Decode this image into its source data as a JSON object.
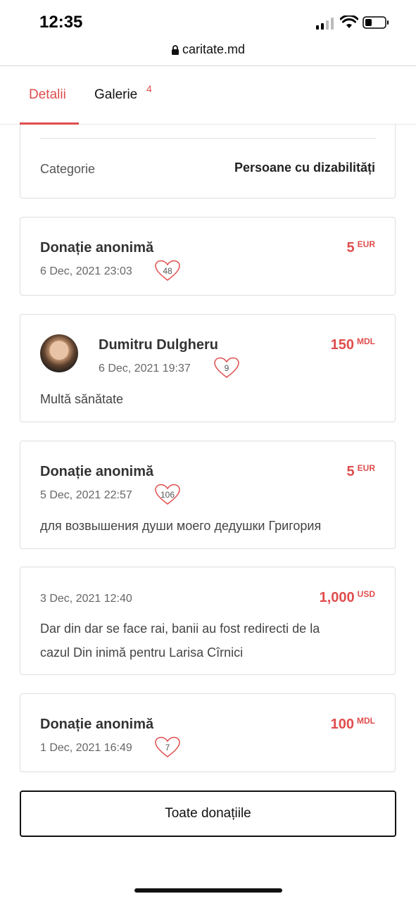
{
  "status": {
    "time": "12:35"
  },
  "browser": {
    "url": "caritate.md"
  },
  "tabs": [
    {
      "label": "Detalii",
      "active": true
    },
    {
      "label": "Galerie",
      "badge": "4"
    }
  ],
  "category": {
    "label": "Categorie",
    "value": "Persoane cu dizabilități"
  },
  "donations": [
    {
      "donor": "Donație anonimă",
      "date": "6 Dec, 2021 23:03",
      "likes": "48",
      "amount": "5",
      "currency": "EUR"
    },
    {
      "donor": "Dumitru Dulgheru",
      "date": "6 Dec, 2021 19:37",
      "likes": "9",
      "amount": "150",
      "currency": "MDL",
      "message": "Multă sănătate"
    },
    {
      "donor": "Donație anonimă",
      "date": "5 Dec, 2021 22:57",
      "likes": "106",
      "amount": "5",
      "currency": "EUR",
      "message": "для возвышения души моего дедушки Григория"
    },
    {
      "date": "3 Dec, 2021 12:40",
      "amount": "1,000",
      "currency": "USD",
      "message_line1": "Dar din dar se face rai, banii au fost redirecti de la",
      "message_line2": "cazul Din inimă pentru Larisa Cîrnici"
    },
    {
      "donor": "Donație anonimă",
      "date": "1 Dec, 2021 16:49",
      "likes": "7",
      "amount": "100",
      "currency": "MDL"
    }
  ],
  "all_donations_label": "Toate donațiile",
  "colors": {
    "accent": "#e04d4d",
    "text": "#333333",
    "border": "#dedede"
  }
}
